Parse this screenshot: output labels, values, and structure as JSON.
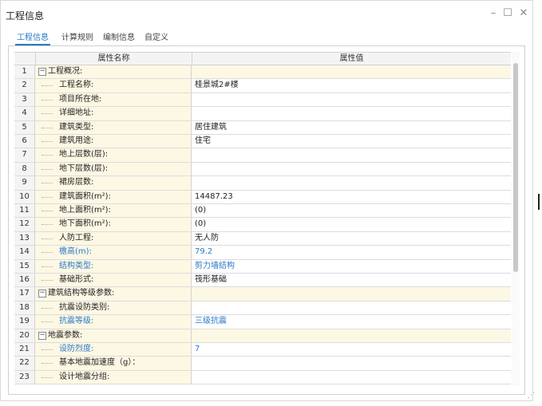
{
  "window": {
    "title": "工程信息",
    "minimize": "–",
    "maximize": "☐",
    "close": "✕"
  },
  "tabs": [
    {
      "label": "工程信息",
      "active": true
    },
    {
      "label": "计算规则",
      "active": false
    },
    {
      "label": "编制信息",
      "active": false
    },
    {
      "label": "自定义",
      "active": false
    }
  ],
  "table": {
    "headers": {
      "name": "属性名称",
      "value": "属性值"
    },
    "rows": [
      {
        "no": "1",
        "name": "工程概况:",
        "value": "",
        "group": true,
        "toggle": "−"
      },
      {
        "no": "2",
        "name": "工程名称:",
        "value": "桂景城2#楼"
      },
      {
        "no": "3",
        "name": "项目所在地:",
        "value": ""
      },
      {
        "no": "4",
        "name": "详细地址:",
        "value": ""
      },
      {
        "no": "5",
        "name": "建筑类型:",
        "value": "居住建筑"
      },
      {
        "no": "6",
        "name": "建筑用途:",
        "value": "住宅"
      },
      {
        "no": "7",
        "name": "地上层数(层):",
        "value": ""
      },
      {
        "no": "8",
        "name": "地下层数(层):",
        "value": ""
      },
      {
        "no": "9",
        "name": "裙房层数:",
        "value": ""
      },
      {
        "no": "10",
        "name": "建筑面积(m²):",
        "value": "14487.23"
      },
      {
        "no": "11",
        "name": "地上面积(m²):",
        "value": "(0)"
      },
      {
        "no": "12",
        "name": "地下面积(m²):",
        "value": "(0)"
      },
      {
        "no": "13",
        "name": "人防工程:",
        "value": "无人防"
      },
      {
        "no": "14",
        "name": "檐高(m):",
        "value": "79.2",
        "blue": true
      },
      {
        "no": "15",
        "name": "结构类型:",
        "value": "剪力墙结构",
        "blue": true
      },
      {
        "no": "16",
        "name": "基础形式:",
        "value": "筏形基础"
      },
      {
        "no": "17",
        "name": "建筑结构等级参数:",
        "value": "",
        "group": true,
        "toggle": "−"
      },
      {
        "no": "18",
        "name": "抗震设防类别:",
        "value": ""
      },
      {
        "no": "19",
        "name": "抗震等级:",
        "value": "三级抗震",
        "blue": true
      },
      {
        "no": "20",
        "name": "地震参数:",
        "value": "",
        "group": true,
        "toggle": "−"
      },
      {
        "no": "21",
        "name": "设防烈度:",
        "value": "7",
        "blue": true
      },
      {
        "no": "22",
        "name": "基本地震加速度（g）：",
        "value": ""
      },
      {
        "no": "23",
        "name": "设计地震分组:",
        "value": ""
      }
    ]
  },
  "colors": {
    "accent": "#2a79c8",
    "name_bg": "#fdf8e4",
    "header_bg": "#f4f4f4"
  },
  "icons": {
    "collapse": "minus-box-icon",
    "resize": "resize-grip-icon"
  }
}
